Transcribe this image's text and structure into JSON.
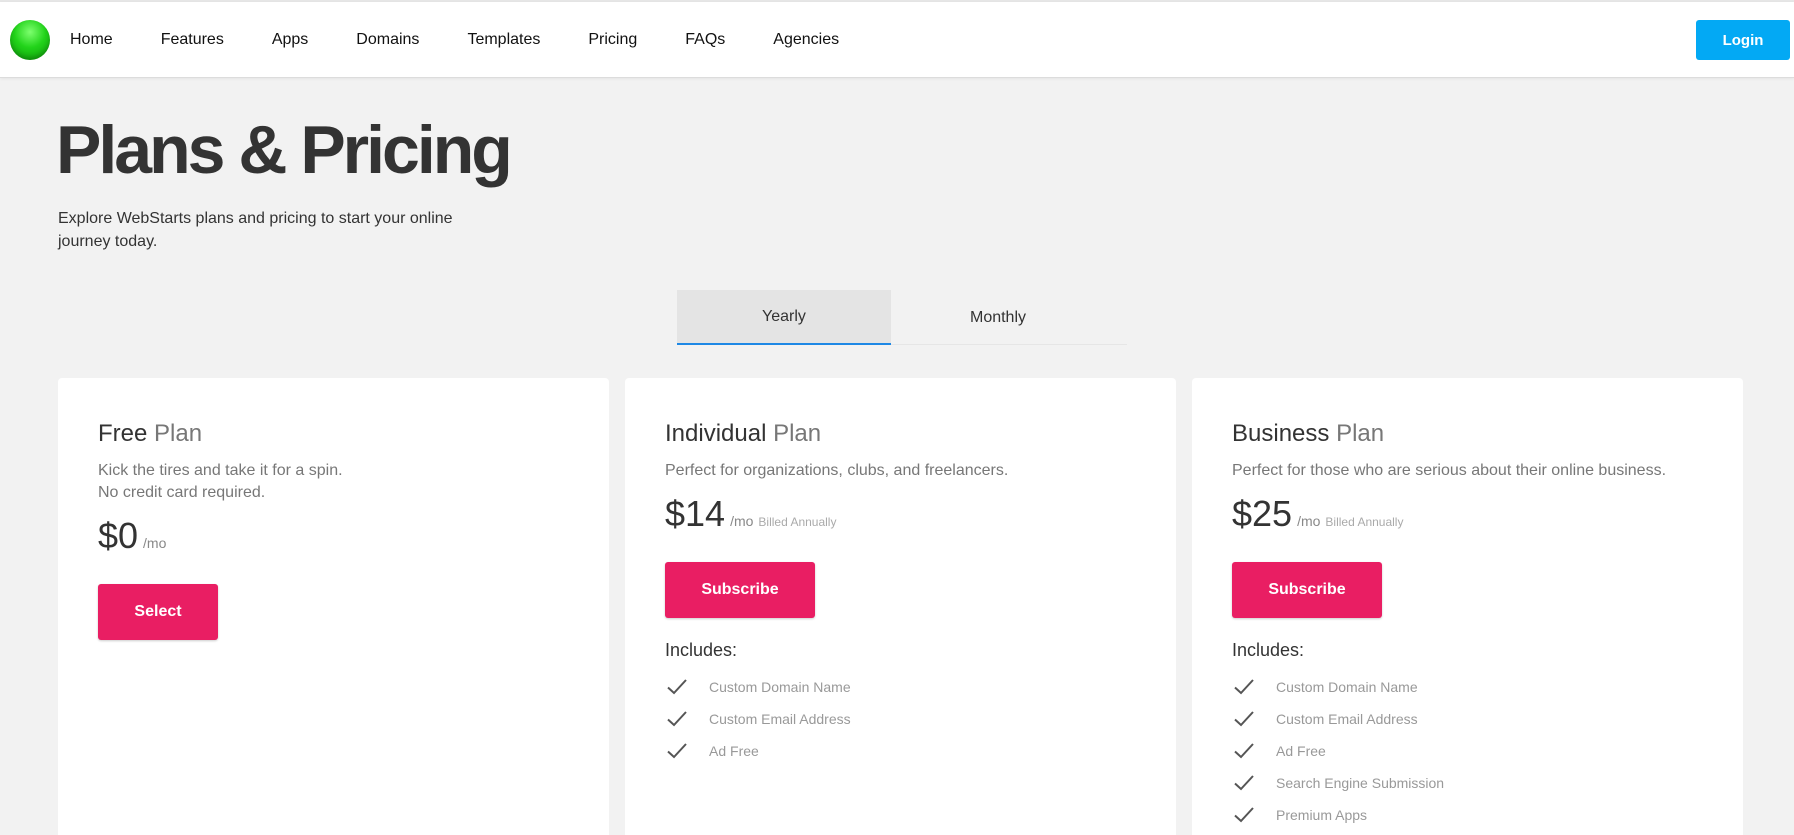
{
  "nav": {
    "links": [
      "Home",
      "Features",
      "Apps",
      "Domains",
      "Templates",
      "Pricing",
      "FAQs",
      "Agencies"
    ],
    "login_label": "Login"
  },
  "hero": {
    "title": "Plans & Pricing",
    "subtitle": "Explore WebStarts plans and pricing to start your online journey today."
  },
  "billing_tabs": {
    "yearly": "Yearly",
    "monthly": "Monthly",
    "selected": "Yearly"
  },
  "plans": [
    {
      "name": "Free",
      "plan_word": "Plan",
      "description_line1": "Kick the tires and take it for a spin.",
      "description_line2": "No credit card required.",
      "price": "$0",
      "per": "/mo",
      "button": "Select"
    },
    {
      "name": "Individual",
      "plan_word": "Plan",
      "description": "Perfect for organizations, clubs, and freelancers.",
      "price": "$14",
      "per": "/mo",
      "billed": "Billed Annually",
      "button": "Subscribe",
      "includes_label": "Includes:",
      "features": [
        "Custom Domain Name",
        "Custom Email Address",
        "Ad Free"
      ]
    },
    {
      "name": "Business",
      "plan_word": "Plan",
      "description": "Perfect for those who are serious about their online business.",
      "price": "$25",
      "per": "/mo",
      "billed": "Billed Annually",
      "button": "Subscribe",
      "includes_label": "Includes:",
      "features": [
        "Custom Domain Name",
        "Custom Email Address",
        "Ad Free",
        "Search Engine Submission",
        "Premium Apps"
      ]
    }
  ],
  "colors": {
    "accent_login": "#03a9f4",
    "cta": "#e91e63",
    "tab_underline": "#1e88e5"
  }
}
